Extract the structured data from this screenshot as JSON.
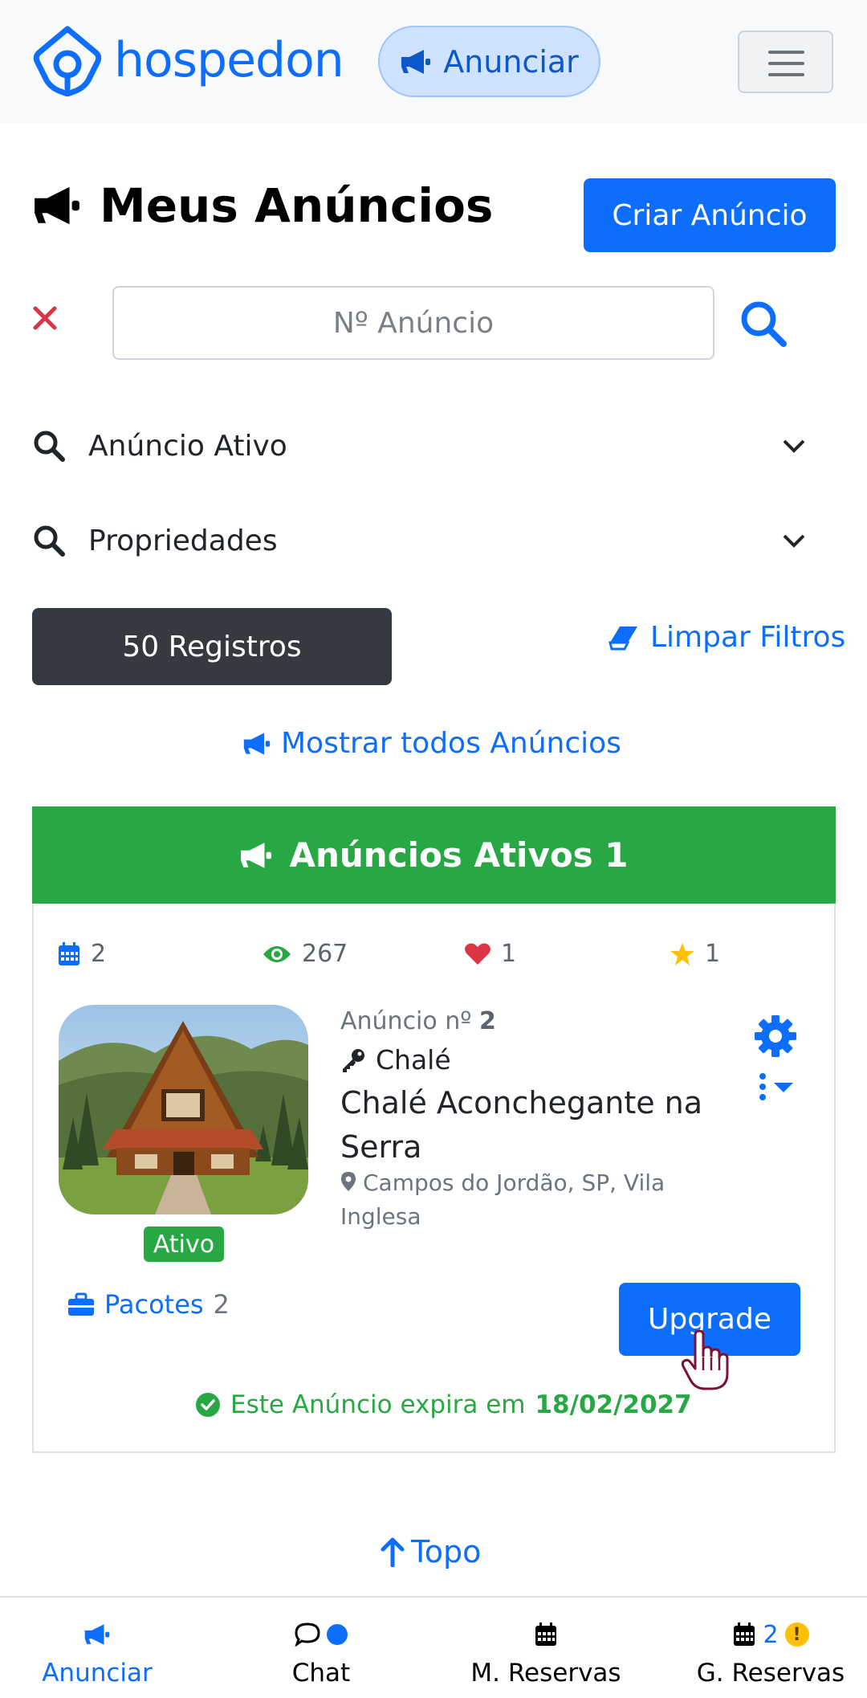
{
  "navbar": {
    "brand": "hospedon",
    "advertise_label": "Anunciar",
    "colors": {
      "brand": "#0d6efd",
      "pill_bg": "#cfe2ff"
    }
  },
  "header": {
    "title": "Meus Anúncios",
    "create_label": "Criar Anúncio",
    "title_icon": "megaphone-icon"
  },
  "search": {
    "placeholder": "Nº Anúncio",
    "value": ""
  },
  "filters": [
    {
      "label": "Anúncio Ativo"
    },
    {
      "label": "Propriedades"
    }
  ],
  "results": {
    "count_label": "50 Registros",
    "clear_filters_label": "Limpar Filtros",
    "show_all_label": "Mostrar todos Anúncios"
  },
  "section": {
    "title": "Anúncios Ativos 1",
    "color": "#28a745"
  },
  "listing": {
    "stats": {
      "reservations": "2",
      "views": "267",
      "favorites": "1",
      "rating": "1"
    },
    "number_label": "Anúncio nº",
    "number": "2",
    "type": "Chalé",
    "title": "Chalé Aconchegante na Serra",
    "location": "Campos do Jordão, SP, Vila Inglesa",
    "status": "Ativo",
    "packages_label": "Pacotes",
    "packages_count": "2",
    "upgrade_label": "Upgrade",
    "expire_text": "Este Anúncio expira em",
    "expire_date": "18/02/2027"
  },
  "back_to_top": "Topo",
  "bottom_nav": {
    "items": [
      {
        "label": "Anunciar",
        "icon": "megaphone-icon",
        "active": true
      },
      {
        "label": "Chat",
        "icon": "chat-bubble-icon"
      },
      {
        "label": "M. Reservas",
        "icon": "calendar-icon"
      },
      {
        "label": "G. Reservas",
        "icon": "calendar-icon",
        "count": "2",
        "alert": "!"
      }
    ]
  }
}
